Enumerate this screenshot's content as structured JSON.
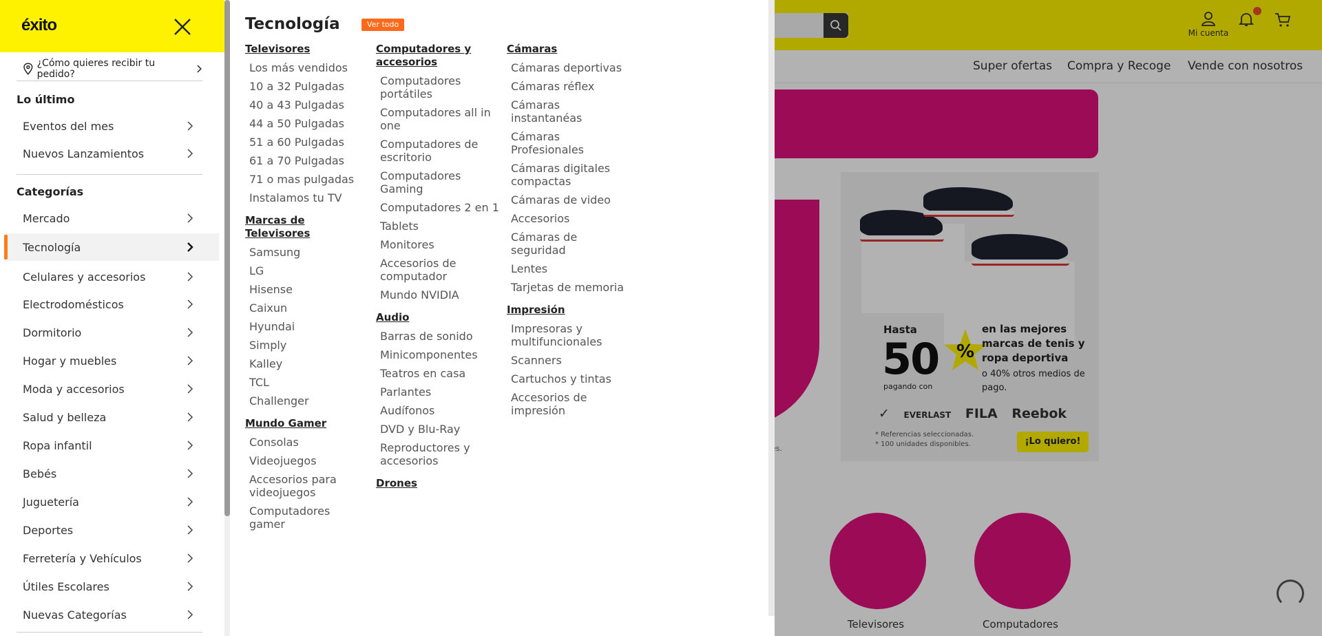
{
  "background": {
    "account_label": "Mi cuenta",
    "subnav": [
      "Super ofertas",
      "Compra y Recoge",
      "Vende con nosotros"
    ],
    "promo": {
      "hasta": "Hasta",
      "big": "50",
      "percent": "%",
      "pagando": "pagando con",
      "headline": "en las mejores marcas de tenis y ropa deportiva",
      "sub": "o 40% otros medios de pago.",
      "brands": [
        "FILA",
        "Reebok",
        "EVERLAST"
      ],
      "fine_1": "* Referencias seleccionadas.",
      "fine_2": "* 100 unidades disponibles.",
      "cta": "¡Lo quiero!",
      "left_foot": "es."
    },
    "categories": [
      {
        "label": "Televisores"
      },
      {
        "label": "Computadores"
      }
    ]
  },
  "side": {
    "logo": "éxito",
    "delivery": "¿Cómo quieres recibir tu pedido?",
    "section_latest": "Lo último",
    "latest_items": [
      {
        "label": "Eventos del mes"
      },
      {
        "label": "Nuevos Lanzamientos"
      }
    ],
    "section_categories": "Categorías",
    "category_items": [
      {
        "label": "Mercado"
      },
      {
        "label": "Tecnología"
      },
      {
        "label": "Celulares y accesorios"
      },
      {
        "label": "Electrodomésticos"
      },
      {
        "label": "Dormitorio"
      },
      {
        "label": "Hogar y muebles"
      },
      {
        "label": "Moda y accesorios"
      },
      {
        "label": "Salud y belleza"
      },
      {
        "label": "Ropa infantil"
      },
      {
        "label": "Bebés"
      },
      {
        "label": "Juguetería"
      },
      {
        "label": "Deportes"
      },
      {
        "label": "Ferretería y Vehículos"
      },
      {
        "label": "Útiles Escolares"
      },
      {
        "label": "Nuevas Categorías"
      }
    ],
    "active_category": "Tecnología"
  },
  "mega": {
    "title": "Tecnología",
    "ver_todo": "Ver todo",
    "columns": [
      {
        "groups": [
          {
            "heading": "Televisores",
            "links": [
              "Los más vendidos",
              "10 a 32 Pulgadas",
              "40 a 43 Pulgadas",
              "44 a 50 Pulgadas",
              "51 a 60 Pulgadas",
              "61 a 70 Pulgadas",
              "71 o mas pulgadas",
              "Instalamos tu TV"
            ]
          },
          {
            "heading": "Marcas de Televisores",
            "links": [
              "Samsung",
              "LG",
              "Hisense",
              "Caixun",
              "Hyundai",
              "Simply",
              "Kalley",
              "TCL",
              "Challenger"
            ]
          },
          {
            "heading": "Mundo Gamer",
            "links": [
              "Consolas",
              "Videojuegos",
              "Accesorios para videojuegos",
              "Computadores gamer"
            ]
          }
        ]
      },
      {
        "groups": [
          {
            "heading": "Computadores y accesorios",
            "links": [
              "Computadores portátiles",
              "Computadores all in one",
              "Computadores de escritorio",
              "Computadores Gaming",
              "Computadores 2 en 1",
              "Tablets",
              "Monitores",
              "Accesorios de computador",
              "Mundo NVIDIA"
            ]
          },
          {
            "heading": "Audio",
            "links": [
              "Barras de sonido",
              "Minicomponentes",
              "Teatros en casa",
              "Parlantes",
              "Audífonos",
              "DVD y Blu-Ray",
              "Reproductores y accesorios"
            ]
          },
          {
            "heading": "Drones",
            "links": []
          }
        ]
      },
      {
        "groups": [
          {
            "heading": "Cámaras",
            "links": [
              "Cámaras deportivas",
              "Cámaras réflex",
              "Cámaras instantanéas",
              "Cámaras Profesionales",
              "Cámaras digitales compactas",
              "Cámaras de video",
              "Accesorios",
              "Cámaras de seguridad",
              "Lentes",
              "Tarjetas de memoria"
            ]
          },
          {
            "heading": "Impresión",
            "links": [
              "Impresoras y multifuncionales",
              "Scanners",
              "Cartuchos y tintas",
              "Accesorios de impresión"
            ]
          }
        ]
      }
    ]
  },
  "colors": {
    "brand_yellow": "#fff200",
    "accent_orange": "#ff6a1a",
    "brand_pink": "#e0117a"
  }
}
